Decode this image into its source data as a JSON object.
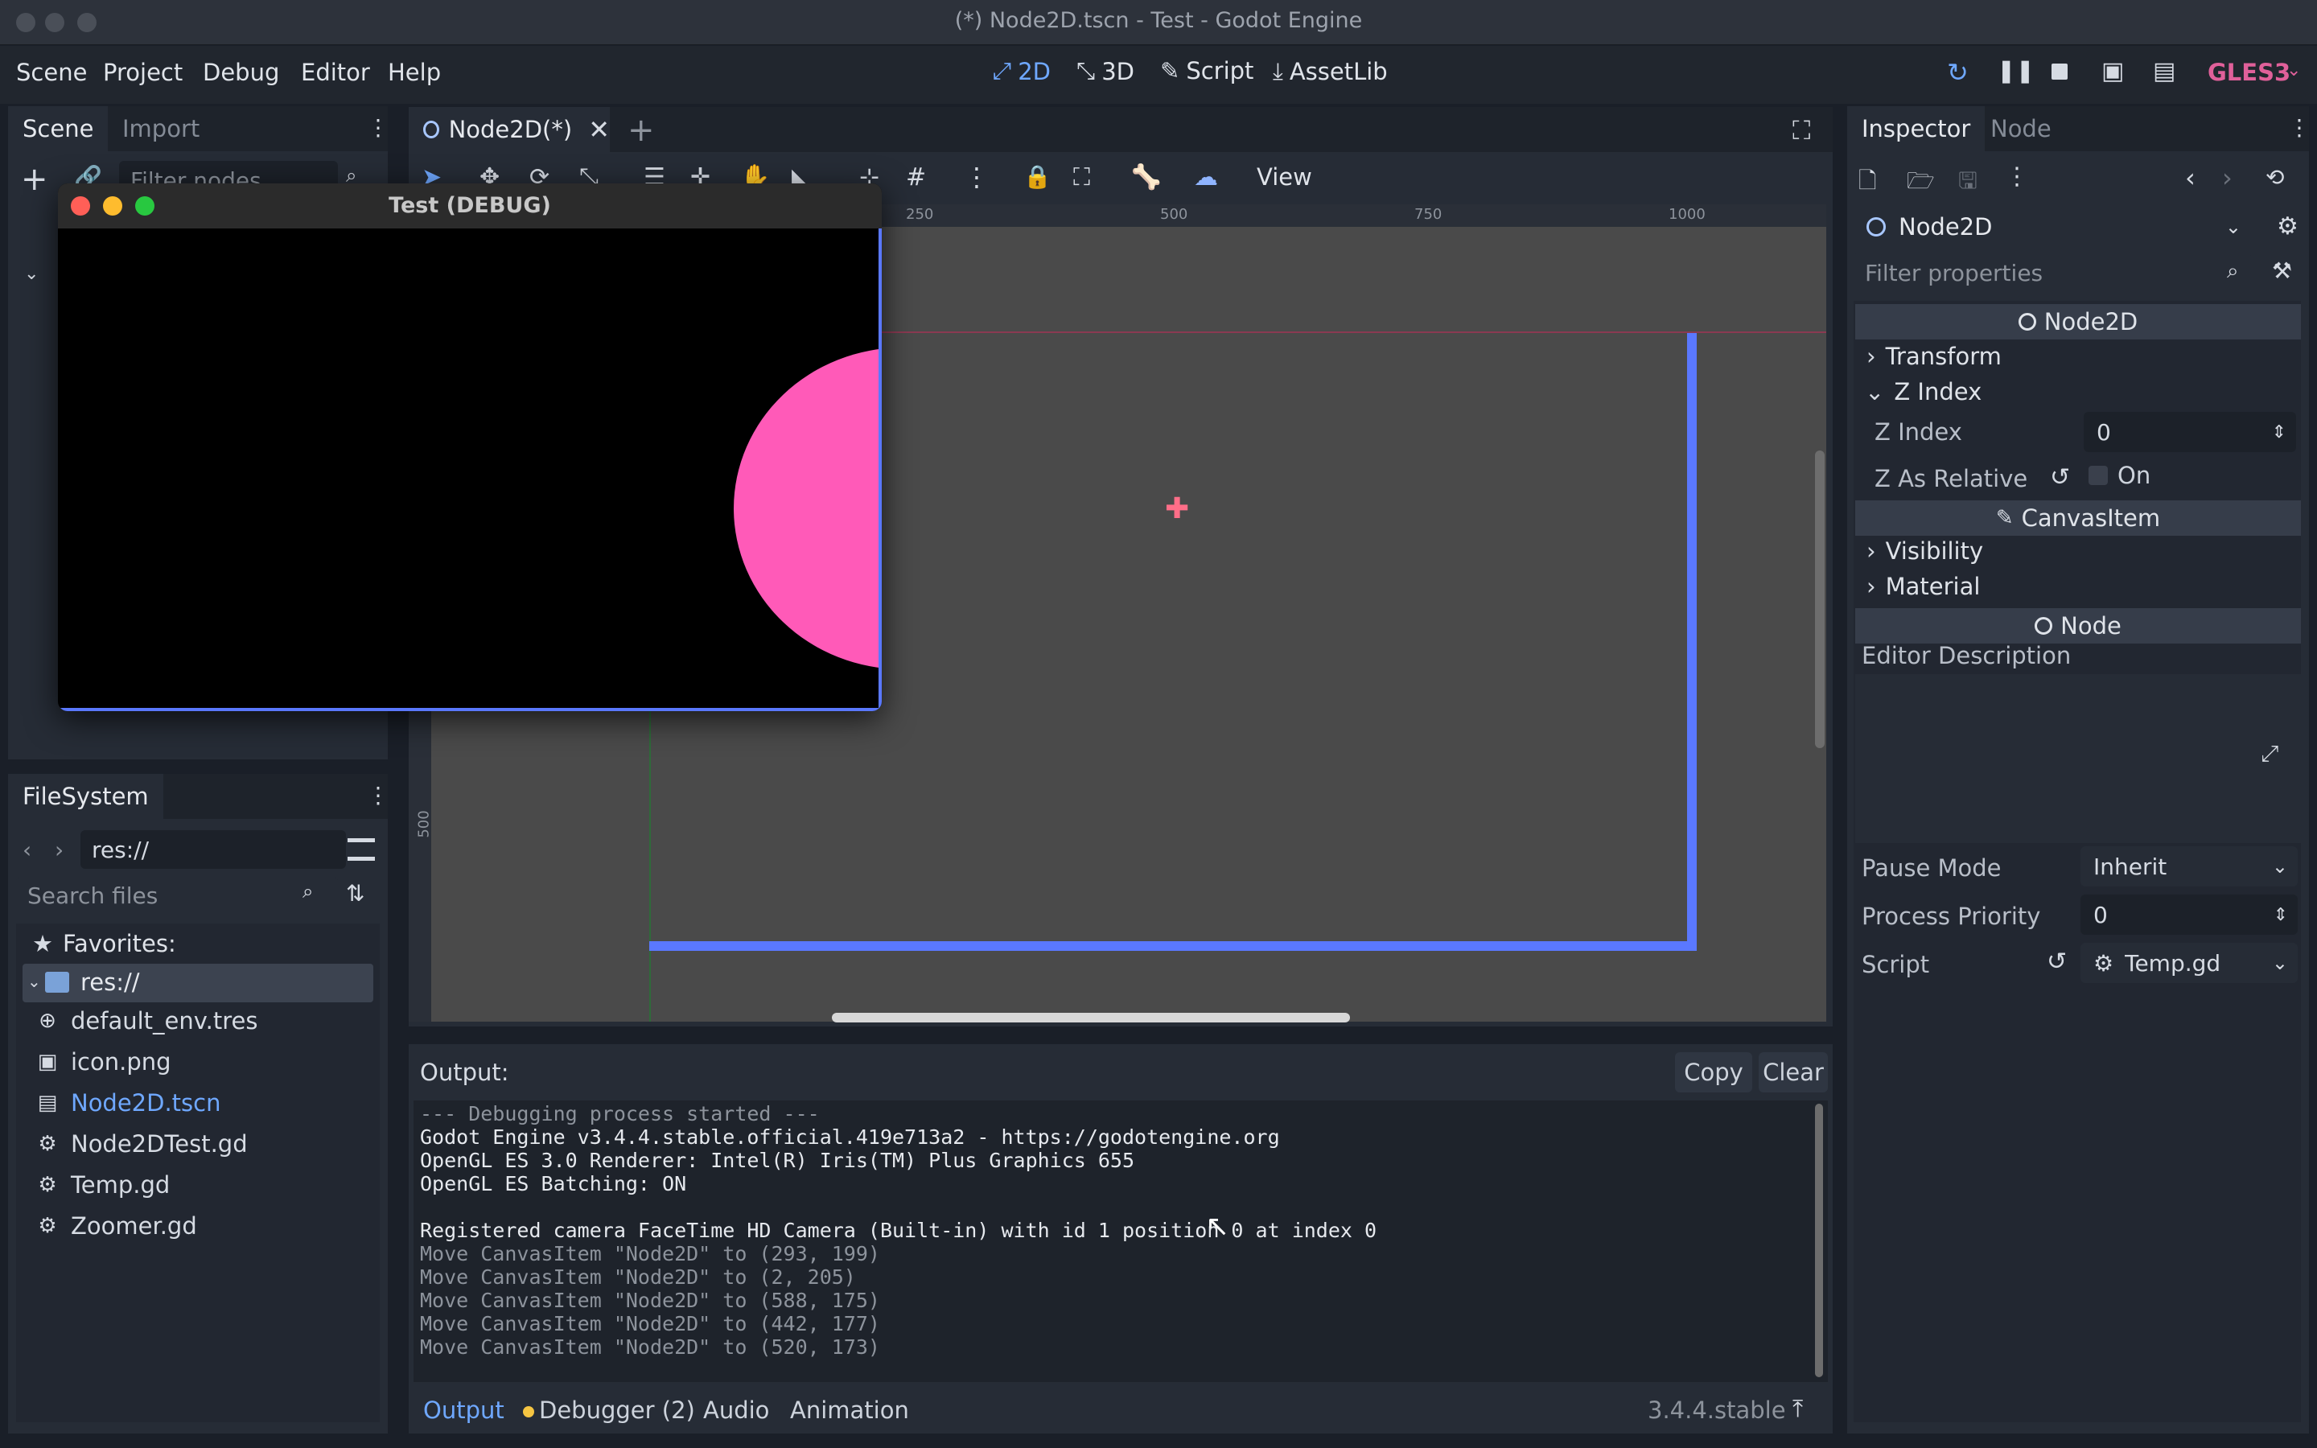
{
  "window": {
    "title": "(*) Node2D.tscn - Test - Godot Engine"
  },
  "menu": {
    "items": [
      "Scene",
      "Project",
      "Debug",
      "Editor",
      "Help"
    ]
  },
  "modes": [
    {
      "label": "2D",
      "icon": "2d-icon"
    },
    {
      "label": "3D",
      "icon": "3d-icon"
    },
    {
      "label": "Script",
      "icon": "script-icon"
    },
    {
      "label": "AssetLib",
      "icon": "download-icon"
    }
  ],
  "renderer": "GLES3",
  "scene_panel": {
    "tabs": [
      "Scene",
      "Import"
    ],
    "filter_placeholder": "Filter nodes"
  },
  "filesystem": {
    "tab": "FileSystem",
    "path": "res://",
    "search_placeholder": "Search files",
    "favorites_label": "Favorites:",
    "root_label": "res://",
    "files": [
      {
        "name": "default_env.tres",
        "icon": "globe-icon",
        "color": "#d6dbe3"
      },
      {
        "name": "icon.png",
        "icon": "image-icon",
        "color": "#d6dbe3"
      },
      {
        "name": "Node2D.tscn",
        "icon": "scene-icon",
        "color": "#6fa8ff"
      },
      {
        "name": "Node2DTest.gd",
        "icon": "gear-icon",
        "color": "#d6dbe3"
      },
      {
        "name": "Temp.gd",
        "icon": "gear-icon",
        "color": "#d6dbe3"
      },
      {
        "name": "Zoomer.gd",
        "icon": "gear-icon",
        "color": "#d6dbe3"
      }
    ]
  },
  "editor_tab": {
    "label": "Node2D(*)"
  },
  "toolbar": {
    "view_label": "View"
  },
  "ruler": {
    "ticks": [
      "250",
      "500",
      "750",
      "1000"
    ],
    "left_tick": "500"
  },
  "debug_window": {
    "title": "Test (DEBUG)"
  },
  "inspector": {
    "tabs": [
      "Inspector",
      "Node"
    ],
    "node_name": "Node2D",
    "filter_placeholder": "Filter properties",
    "section_node2d": "Node2D",
    "transform": "Transform",
    "z_index_group": "Z Index",
    "z_index_label": "Z Index",
    "z_index_value": "0",
    "z_as_relative_label": "Z As Relative",
    "z_as_relative_value": "On",
    "section_canvasitem": "CanvasItem",
    "visibility": "Visibility",
    "material": "Material",
    "section_node": "Node",
    "editor_description": "Editor Description",
    "pause_mode_label": "Pause Mode",
    "pause_mode_value": "Inherit",
    "process_priority_label": "Process Priority",
    "process_priority_value": "0",
    "script_label": "Script",
    "script_value": "Temp.gd"
  },
  "output": {
    "label": "Output:",
    "copy": "Copy",
    "clear": "Clear",
    "lines": [
      {
        "text": "--- Debugging process started ---",
        "dim": true
      },
      {
        "text": "Godot Engine v3.4.4.stable.official.419e713a2 - https://godotengine.org",
        "dim": false
      },
      {
        "text": "OpenGL ES 3.0 Renderer: Intel(R) Iris(TM) Plus Graphics 655",
        "dim": false
      },
      {
        "text": "OpenGL ES Batching: ON",
        "dim": false
      },
      {
        "text": "",
        "dim": false
      },
      {
        "text": "Registered camera FaceTime HD Camera (Built-in) with id 1 position 0 at index 0",
        "dim": false
      },
      {
        "text": "Move CanvasItem \"Node2D\" to (293, 199)",
        "dim": true
      },
      {
        "text": "Move CanvasItem \"Node2D\" to (2, 205)",
        "dim": true
      },
      {
        "text": "Move CanvasItem \"Node2D\" to (588, 175)",
        "dim": true
      },
      {
        "text": "Move CanvasItem \"Node2D\" to (442, 177)",
        "dim": true
      },
      {
        "text": "Move CanvasItem \"Node2D\" to (520, 173)",
        "dim": true
      }
    ]
  },
  "bottom_tabs": [
    "Output",
    "Debugger (2)",
    "Audio",
    "Animation"
  ],
  "version": "3.4.4.stable",
  "colors": {
    "accent": "#6fa8ff",
    "renderer": "#e0609a",
    "circle": "#ff5ab8",
    "frame": "#5a78ff"
  }
}
